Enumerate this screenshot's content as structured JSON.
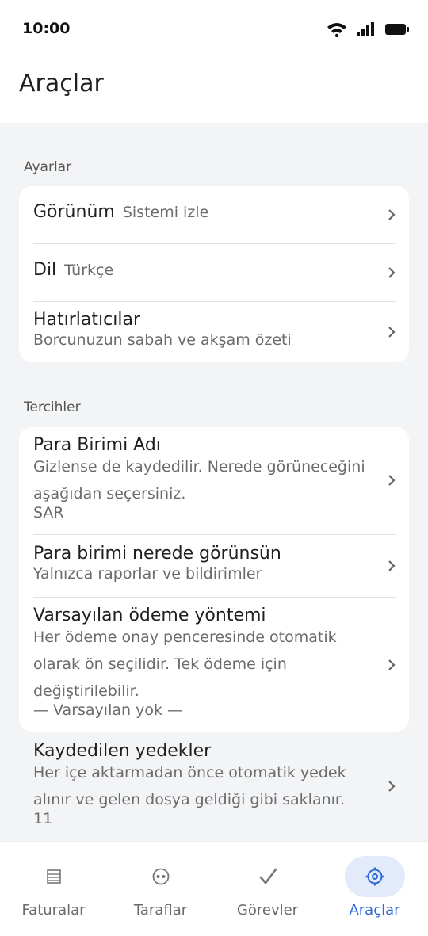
{
  "status_bar": {
    "time": "10:00"
  },
  "header": {
    "title": "Araçlar"
  },
  "sections": {
    "settings": {
      "title": "Ayarlar",
      "appearance": {
        "title": "Görünüm",
        "value": "Sistemi izle"
      },
      "language": {
        "title": "Dil",
        "value": "Türkçe"
      },
      "reminders": {
        "title": "Hatırlatıcılar",
        "subtitle": "Borcunuzun sabah ve akşam özeti"
      }
    },
    "preferences": {
      "title": "Tercihler",
      "currency_name": {
        "title": "Para Birimi Adı",
        "subtitle_line1": "Gizlense de kaydedilir. Nerede görüneceğini",
        "subtitle_line2": "aşağıdan seçersiniz.",
        "value": "SAR"
      },
      "currency_display": {
        "title": "Para birimi nerede görünsün",
        "subtitle": "Yalnızca raporlar ve bildirimler"
      },
      "default_payment": {
        "title": "Varsayılan ödeme yöntemi",
        "subtitle_line1": "Her ödeme onay penceresinde otomatik",
        "subtitle_line2": "olarak ön seçilidir. Tek ödeme için",
        "subtitle_line3": "değiştirilebilir.",
        "value": "— Varsayılan yok —"
      },
      "saved_backups": {
        "title": "Kaydedilen yedekler",
        "subtitle_line1": "Her içe aktarmadan önce otomatik yedek",
        "subtitle_line2": "alınır ve gelen dosya geldiği gibi saklanır.",
        "value": "11"
      }
    }
  },
  "bottom_nav": {
    "items": [
      {
        "label": "Faturalar",
        "icon": "list-icon"
      },
      {
        "label": "Taraflar",
        "icon": "parties-icon"
      },
      {
        "label": "Görevler",
        "icon": "check-icon"
      },
      {
        "label": "Araçlar",
        "icon": "gear-icon",
        "active": true
      }
    ]
  },
  "colors": {
    "accent": "#2f6bd6",
    "active_pill": "#e3ebfa",
    "background": "#f3f4f6"
  }
}
